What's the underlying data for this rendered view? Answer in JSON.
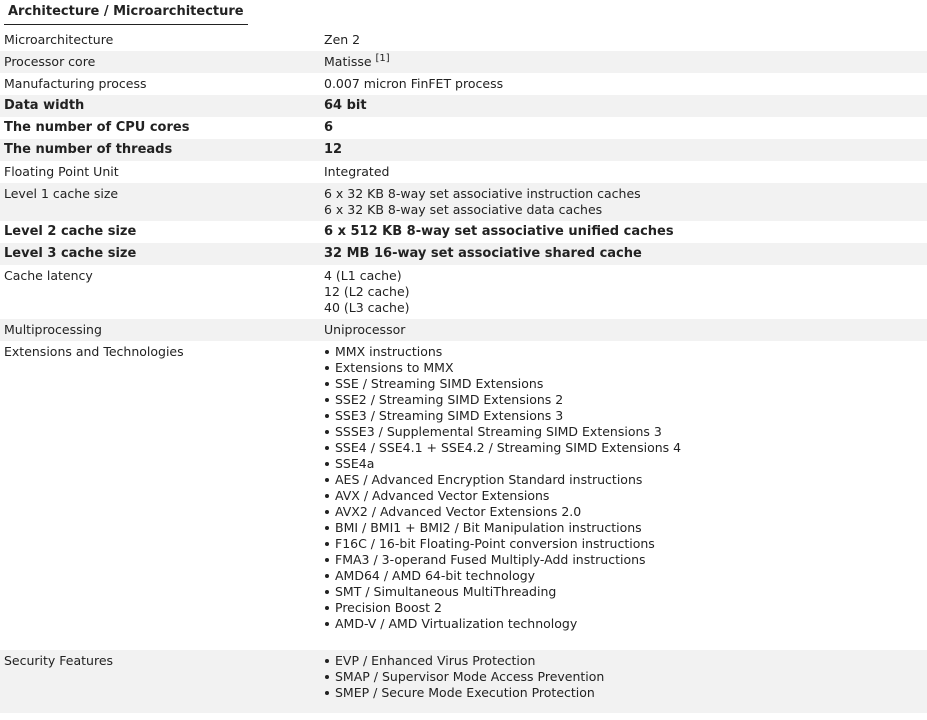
{
  "heading": "Architecture / Microarchitecture",
  "rows": {
    "microarchitecture": {
      "label": "Microarchitecture",
      "value": "Zen 2"
    },
    "processor_core": {
      "label": "Processor core",
      "value": "Matisse",
      "ref": "[1]"
    },
    "manufacturing": {
      "label": "Manufacturing process",
      "value": "0.007 micron FinFET process"
    },
    "data_width": {
      "label": "Data width",
      "value": "64 bit"
    },
    "cpu_cores": {
      "label": "The number of CPU cores",
      "value": "6"
    },
    "threads": {
      "label": "The number of threads",
      "value": "12"
    },
    "fpu": {
      "label": "Floating Point Unit",
      "value": "Integrated"
    },
    "l1": {
      "label": "Level 1 cache size",
      "lines": [
        "6 x 32 KB 8-way set associative instruction caches",
        "6 x 32 KB 8-way set associative data caches"
      ]
    },
    "l2": {
      "label": "Level 2 cache size",
      "value": "6 x 512 KB 8-way set associative unified caches"
    },
    "l3": {
      "label": "Level 3 cache size",
      "value": "32 MB 16-way set associative shared cache"
    },
    "latency": {
      "label": "Cache latency",
      "lines": [
        "4 (L1 cache)",
        "12 (L2 cache)",
        "40 (L3 cache)"
      ]
    },
    "multiprocessing": {
      "label": "Multiprocessing",
      "value": "Uniprocessor"
    },
    "extensions": {
      "label": "Extensions and Technologies",
      "items": [
        "MMX instructions",
        "Extensions to MMX",
        "SSE / Streaming SIMD Extensions",
        "SSE2 / Streaming SIMD Extensions 2",
        "SSE3 / Streaming SIMD Extensions 3",
        "SSSE3 / Supplemental Streaming SIMD Extensions 3",
        "SSE4 / SSE4.1 + SSE4.2 / Streaming SIMD Extensions 4",
        "SSE4a",
        "AES / Advanced Encryption Standard instructions",
        "AVX / Advanced Vector Extensions",
        "AVX2 / Advanced Vector Extensions 2.0",
        "BMI / BMI1 + BMI2 / Bit Manipulation instructions",
        "F16C / 16-bit Floating-Point conversion instructions",
        "FMA3 / 3-operand Fused Multiply-Add instructions",
        "AMD64 / AMD 64-bit technology",
        "SMT / Simultaneous MultiThreading",
        "Precision Boost 2",
        "AMD-V / AMD Virtualization technology"
      ]
    },
    "security": {
      "label": "Security Features",
      "items": [
        "EVP / Enhanced Virus Protection",
        "SMAP / Supervisor Mode Access Prevention",
        "SMEP / Secure Mode Execution Protection"
      ]
    }
  }
}
